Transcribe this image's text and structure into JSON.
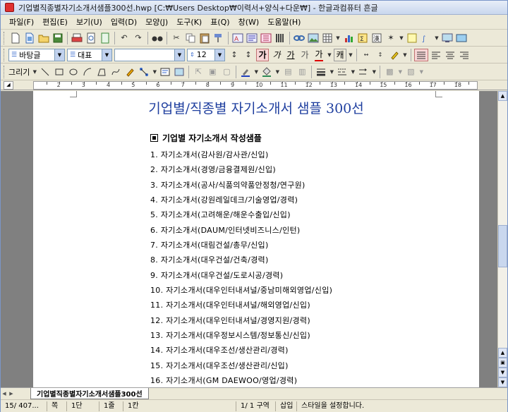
{
  "window": {
    "title": "기업별직종별자기소개서샘플300선.hwp [C:₩Users              Desktop₩이력서+양식+다운₩] - 한글과컴퓨터 흔글"
  },
  "menu": [
    "파일(F)",
    "편집(E)",
    "보기(U)",
    "입력(D)",
    "모양(J)",
    "도구(K)",
    "표(Q)",
    "창(W)",
    "도움말(H)"
  ],
  "format_toolbar": {
    "style": "바탕글",
    "font_lang": "대표",
    "font_name": "",
    "font_size": "12",
    "bold_label": "가",
    "italic_label": "가",
    "underline_label": "가",
    "outline_label": "가",
    "color_label": "가",
    "char_label": "캐"
  },
  "draw_toolbar": {
    "draw_label": "그리기"
  },
  "ruler": {
    "numbers": [
      "2",
      "3",
      "4",
      "5",
      "6",
      "7",
      "8",
      "9",
      "10",
      "11",
      "12",
      "13",
      "14",
      "15",
      "16",
      "17",
      "18"
    ]
  },
  "document": {
    "title": "기업별/직종별 자기소개서 샘플 300선",
    "heading": "기업별 자기소개서 작성샘플",
    "items": [
      "1. 자기소개서(감사원/감사관/신입)",
      "2. 자기소개서(경영/금융결제원/신입)",
      "3. 자기소개서(공사/식품의약품안정청/연구원)",
      "4. 자기소개서(강원레일데크/기술영업/경력)",
      "5. 자기소개서(고려해운/해운수출입/신입)",
      "6. 자기소개서(DAUM/인터넷비즈니스/인턴)",
      "7. 자기소개서(대림건설/총무/신입)",
      "8. 자기소개서(대우건설/건축/경력)",
      "9. 자기소개서(대우건설/도로시공/경력)",
      "10. 자기소개서(대우인터내셔널/중남미해외영업/신입)",
      "11. 자기소개서(대우인터내셔널/해외영업/신입)",
      "12. 자기소개서(대우인터내셔널/경영지원/경력)",
      "13. 자기소개서(대우정보시스템/정보통신/신입)",
      "14. 자기소개서(대우조선/생산관리/경력)",
      "15. 자기소개서(대우조선/생산관리/신입)",
      "16. 자기소개서(GM DAEWOO/영업/경력)"
    ]
  },
  "tab": {
    "label": "기업별직종별자기소개서샘플300선"
  },
  "status": {
    "page": "15/ 407...",
    "page_unit": "쪽",
    "column": "1단",
    "line": "1줄",
    "char": "1칸",
    "section": "1/  1 구역",
    "mode": "삽입",
    "message": "스타일을 설정합니다."
  }
}
